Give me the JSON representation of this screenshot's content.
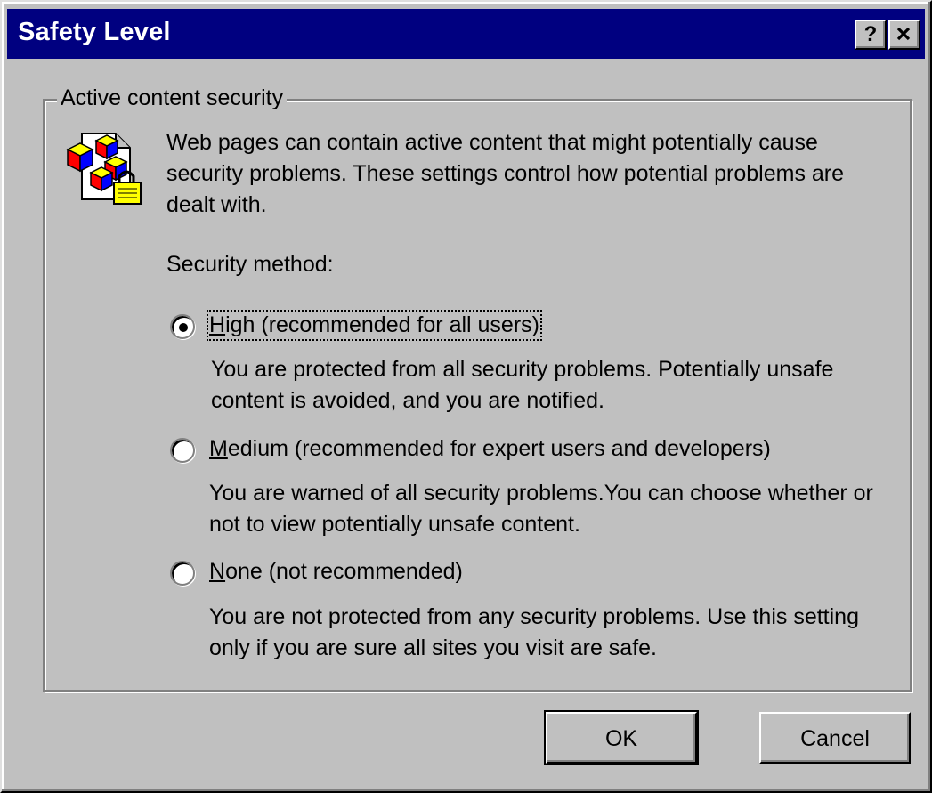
{
  "window": {
    "title": "Safety Level",
    "help_glyph": "?",
    "close_icon": "close-icon"
  },
  "group": {
    "legend": "Active content security",
    "icon": "shield-lock-icon",
    "intro": "Web pages can contain active content that might potentially cause security problems. These settings control how potential problems are dealt with.",
    "method_label": "Security method:"
  },
  "options": [
    {
      "key": "H",
      "rest": "igh (recommended for all users)",
      "desc": "You are protected from all security problems. Potentially unsafe content is avoided, and you are notified.",
      "selected": true
    },
    {
      "key": "M",
      "rest": "edium (recommended for expert users and developers)",
      "desc": "You are warned of all security problems.You can choose whether or not to view potentially unsafe content.",
      "selected": false
    },
    {
      "key": "N",
      "rest": "one  (not recommended)",
      "desc": "You are not protected from any security problems. Use this setting only if you are sure all sites you visit are safe.",
      "selected": false
    }
  ],
  "buttons": {
    "ok": "OK",
    "cancel": "Cancel"
  }
}
